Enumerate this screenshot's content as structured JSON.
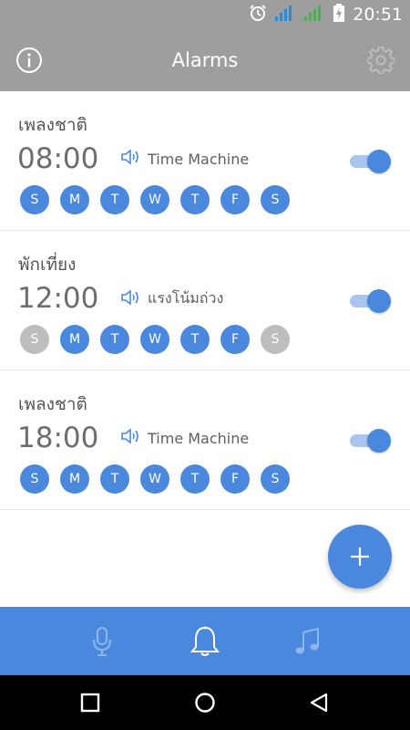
{
  "status_bar": {
    "time": "20:51",
    "icons": [
      "alarm-clock-icon",
      "signal-icon",
      "signal-icon",
      "battery-charging-icon"
    ]
  },
  "app_bar": {
    "title": "Alarms",
    "left_icon": "info-icon",
    "right_icon": "gear-icon"
  },
  "alarms": [
    {
      "name": "เพลงชาติ",
      "time": "08:00",
      "sound": "Time Machine",
      "enabled": true,
      "days": [
        {
          "label": "S",
          "active": true
        },
        {
          "label": "M",
          "active": true
        },
        {
          "label": "T",
          "active": true
        },
        {
          "label": "W",
          "active": true
        },
        {
          "label": "T",
          "active": true
        },
        {
          "label": "F",
          "active": true
        },
        {
          "label": "S",
          "active": true
        }
      ]
    },
    {
      "name": "พักเที่ยง",
      "time": "12:00",
      "sound": "แรงโน้มถ่วง",
      "enabled": true,
      "days": [
        {
          "label": "S",
          "active": false
        },
        {
          "label": "M",
          "active": true
        },
        {
          "label": "T",
          "active": true
        },
        {
          "label": "W",
          "active": true
        },
        {
          "label": "T",
          "active": true
        },
        {
          "label": "F",
          "active": true
        },
        {
          "label": "S",
          "active": false
        }
      ]
    },
    {
      "name": "เพลงชาติ",
      "time": "18:00",
      "sound": "Time Machine",
      "enabled": true,
      "days": [
        {
          "label": "S",
          "active": true
        },
        {
          "label": "M",
          "active": true
        },
        {
          "label": "T",
          "active": true
        },
        {
          "label": "W",
          "active": true
        },
        {
          "label": "T",
          "active": true
        },
        {
          "label": "F",
          "active": true
        },
        {
          "label": "S",
          "active": true
        }
      ]
    }
  ],
  "bottom_nav": [
    {
      "icon": "microphone-icon",
      "selected": false
    },
    {
      "icon": "bell-icon",
      "selected": true
    },
    {
      "icon": "music-note-icon",
      "selected": false
    }
  ],
  "colors": {
    "accent": "#4a88de",
    "toolbar": "#9e9e9e",
    "inactive_day": "#bdbdbd"
  }
}
